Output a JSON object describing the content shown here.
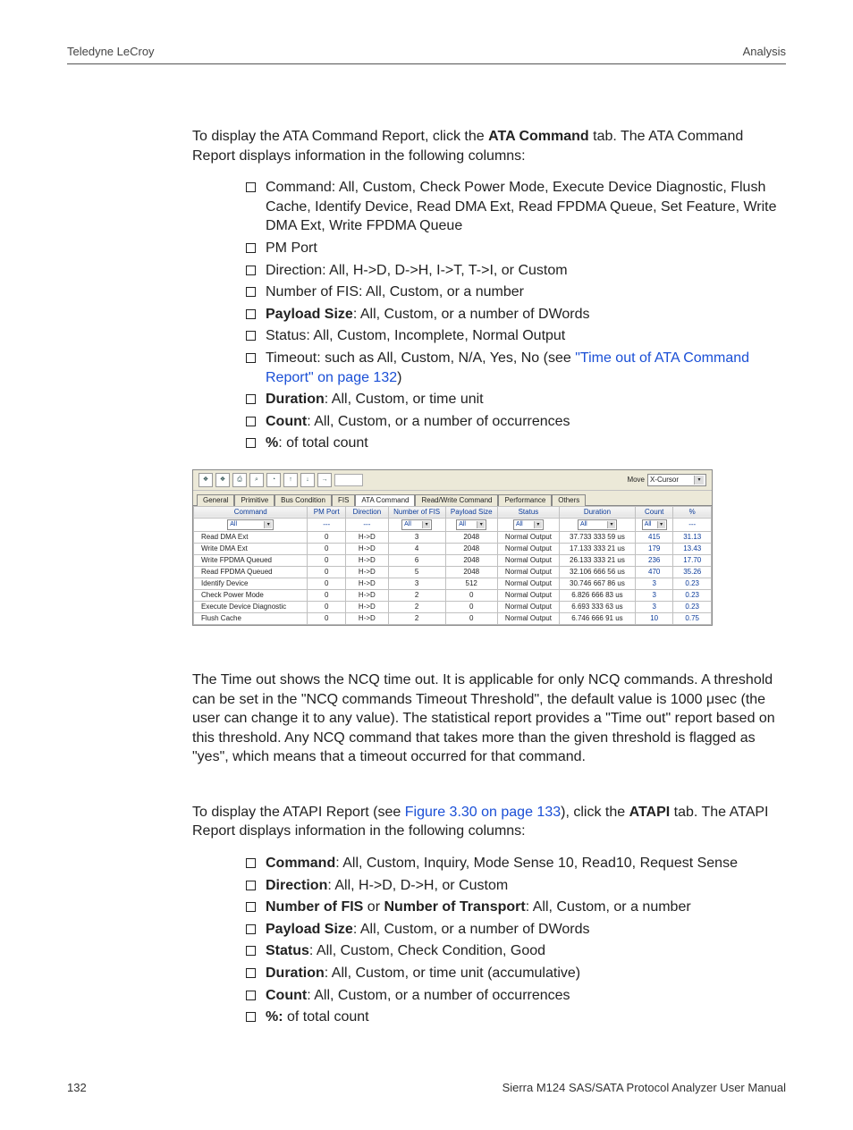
{
  "header": {
    "left": "Teledyne LeCroy",
    "right": "Analysis"
  },
  "body": {
    "intro1_a": "To display the ATA Command Report, click the ",
    "intro1_b": "ATA Command",
    "intro1_c": " tab. The ATA Command Report displays information in the following columns:",
    "ata_bullets": [
      {
        "prefix": "",
        "bold": "",
        "text": "Command: All, Custom, Check Power Mode, Execute Device Diagnostic, Flush Cache, Identify Device, Read DMA Ext, Read FPDMA Queue, Set Feature, Write DMA Ext, Write FPDMA Queue"
      },
      {
        "prefix": "",
        "bold": "",
        "text": "PM Port"
      },
      {
        "prefix": "",
        "bold": "",
        "text": "Direction: All, H->D, D->H, I->T, T->I, or Custom"
      },
      {
        "prefix": "",
        "bold": "",
        "text": "Number of FIS: All, Custom, or a number"
      },
      {
        "prefix": "",
        "bold": "Payload Size",
        "text": ": All, Custom, or a number of DWords"
      },
      {
        "prefix": "",
        "bold": "",
        "text": "Status: All, Custom, Incomplete, Normal Output"
      },
      {
        "prefix": "Timeout: such as All, Custom, N/A, Yes, No (see ",
        "link": "\"Time out of ATA Command Report\" on page 132",
        "suffix": ")"
      },
      {
        "prefix": "",
        "bold": "Duration",
        "text": ": All, Custom, or time unit"
      },
      {
        "prefix": "",
        "bold": "Count",
        "text": ": All, Custom, or a number of occurrences"
      },
      {
        "prefix": "",
        "bold": "%",
        "text": ": of total count"
      }
    ],
    "para2": "The Time out shows the NCQ time out. It is applicable for only NCQ commands. A threshold can be set in the \"NCQ commands Timeout Threshold\", the default value is 1000 μsec (the user can change it to any value). The statistical report provides a \"Time out\" report based on this threshold. Any NCQ command that takes more than the given threshold is flagged as \"yes\", which means that a timeout occurred for that command.",
    "intro3_a": "To display the ATAPI Report (see ",
    "intro3_link": "Figure 3.30 on page 133",
    "intro3_b": "), click the ",
    "intro3_bold": "ATAPI",
    "intro3_c": " tab. The ATAPI Report displays information in the following columns:",
    "atapi_bullets": [
      {
        "bold": "Command",
        "text": ": All, Custom, Inquiry, Mode Sense 10, Read10, Request Sense"
      },
      {
        "bold": "Direction",
        "text": ": All, H->D, D->H, or Custom"
      },
      {
        "bold": "Number of FIS",
        "text_mid": " or ",
        "bold2": "Number of Transport",
        "text": ": All, Custom, or a number"
      },
      {
        "bold": "Payload Size",
        "text": ": All, Custom, or a number of DWords"
      },
      {
        "bold": "Status",
        "text": ": All, Custom, Check Condition, Good"
      },
      {
        "bold": "Duration",
        "text": ": All, Custom, or time unit (accumulative)"
      },
      {
        "bold": "Count",
        "text": ": All, Custom, or a number of occurrences"
      },
      {
        "bold": "%:",
        "text": " of total count"
      }
    ]
  },
  "report": {
    "move_label": "Move",
    "move_value": "X-Cursor",
    "tabs": [
      "General",
      "Primitive",
      "Bus Condition",
      "FIS",
      "ATA Command",
      "Read/Write Command",
      "Performance",
      "Others"
    ],
    "active_tab": 4,
    "columns": [
      "Command",
      "PM Port",
      "Direction",
      "Number of FIS",
      "Payload Size",
      "Status",
      "Duration",
      "Count",
      "%"
    ],
    "filter_row": [
      "All",
      "---",
      "---",
      "All",
      "All",
      "All",
      "All",
      "All",
      "---"
    ],
    "rows": [
      [
        "Read DMA Ext",
        "0",
        "H->D",
        "3",
        "2048",
        "Normal Output",
        "37.733 333 59  us",
        "415",
        "31.13"
      ],
      [
        "Write DMA Ext",
        "0",
        "H->D",
        "4",
        "2048",
        "Normal Output",
        "17.133 333 21  us",
        "179",
        "13.43"
      ],
      [
        "Write FPDMA Queued",
        "0",
        "H->D",
        "6",
        "2048",
        "Normal Output",
        "26.133 333 21  us",
        "236",
        "17.70"
      ],
      [
        "Read FPDMA Queued",
        "0",
        "H->D",
        "5",
        "2048",
        "Normal Output",
        "32.106 666 56  us",
        "470",
        "35.26"
      ],
      [
        "Identify Device",
        "0",
        "H->D",
        "3",
        "512",
        "Normal Output",
        "30.746 667 86  us",
        "3",
        "0.23"
      ],
      [
        "Check Power Mode",
        "0",
        "H->D",
        "2",
        "0",
        "Normal Output",
        "6.826 666 83  us",
        "3",
        "0.23"
      ],
      [
        "Execute Device Diagnostic",
        "0",
        "H->D",
        "2",
        "0",
        "Normal Output",
        "6.693 333 63  us",
        "3",
        "0.23"
      ],
      [
        "Flush Cache",
        "0",
        "H->D",
        "2",
        "0",
        "Normal Output",
        "6.746 666 91  us",
        "10",
        "0.75"
      ]
    ]
  },
  "footer": {
    "left": "132",
    "right": "Sierra M124 SAS/SATA Protocol Analyzer User Manual"
  },
  "icons": {
    "t1": "❖",
    "t2": "❖",
    "t3": "⎙",
    "t4": "⌕",
    "t5": "◔",
    "up": "↑",
    "dn": "↓",
    "rt": "→"
  }
}
